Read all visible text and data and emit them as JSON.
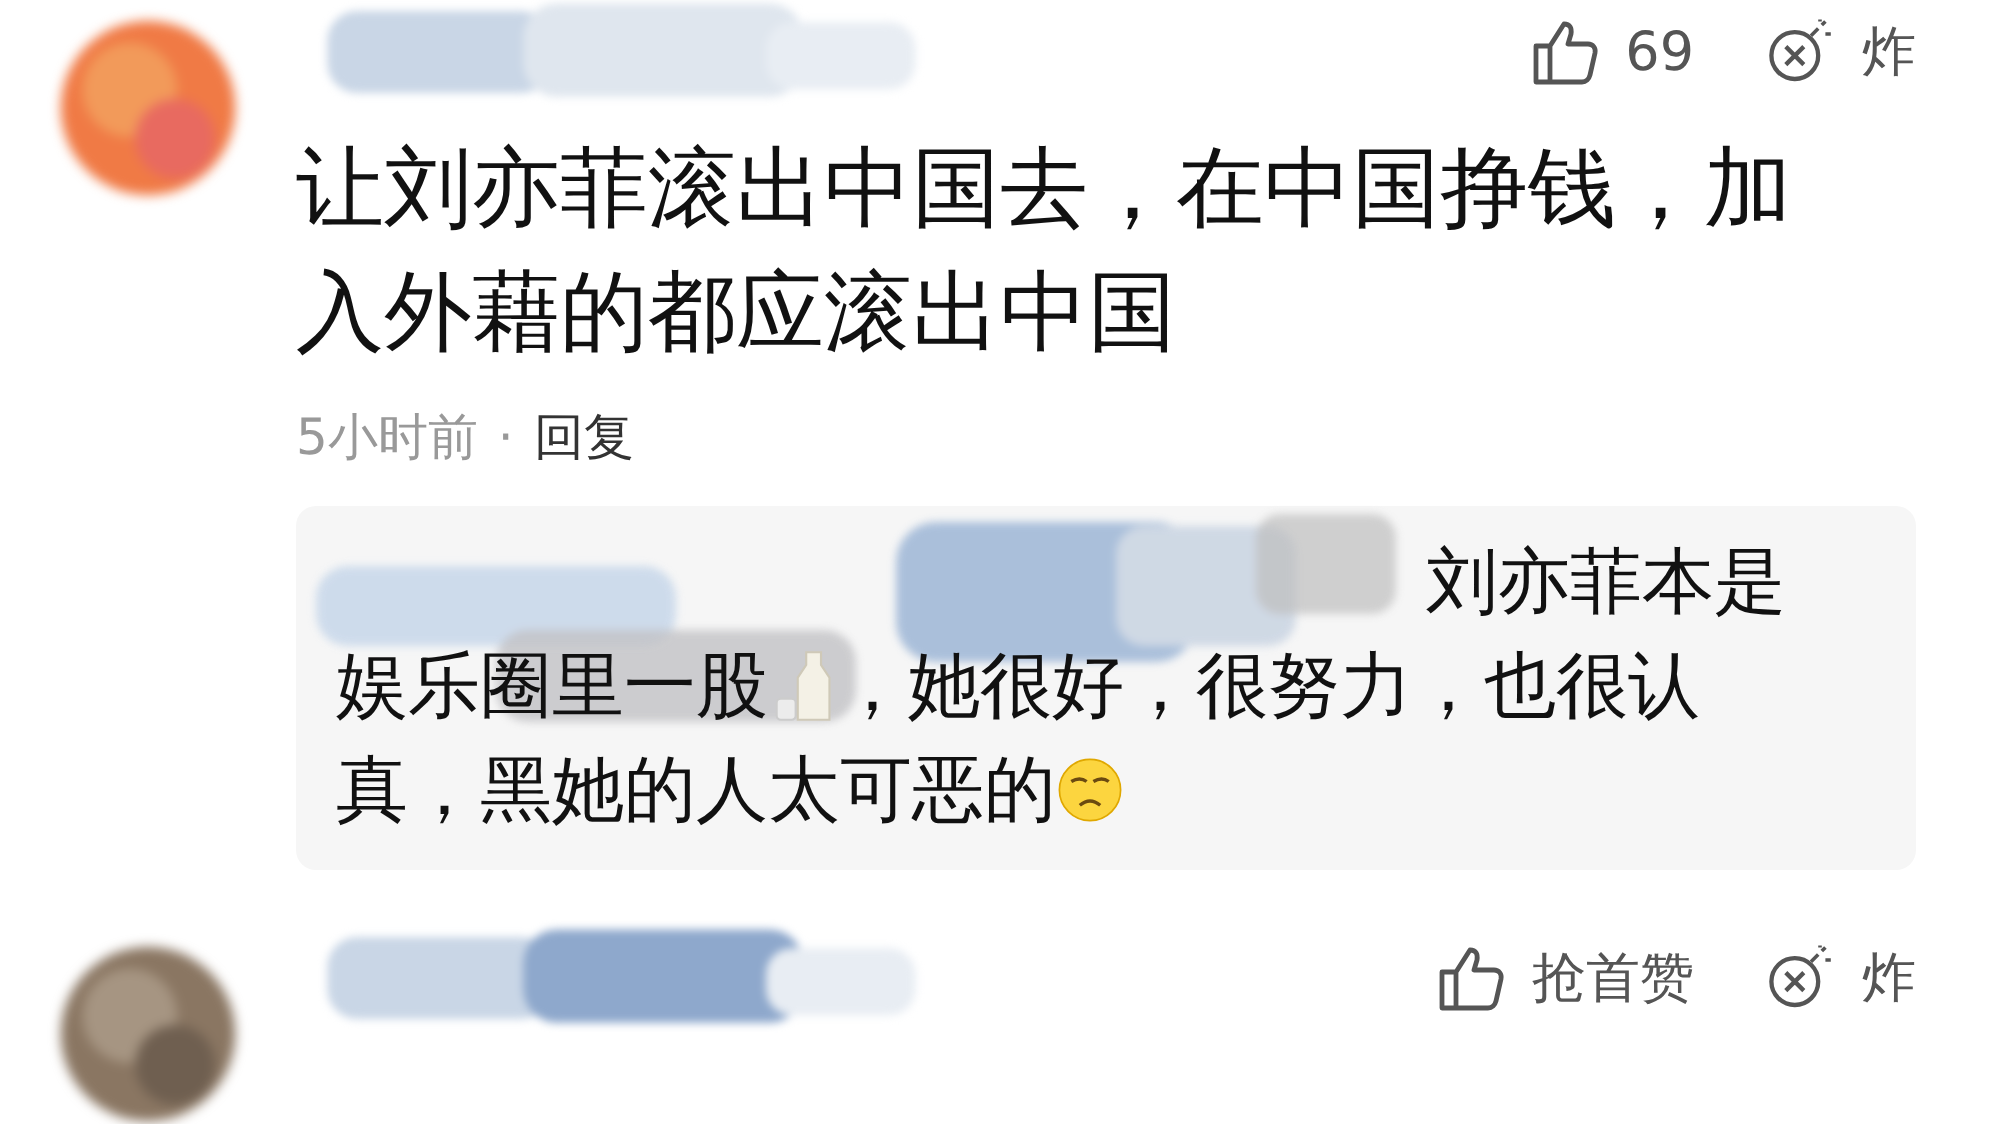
{
  "comments": [
    {
      "likes": "69",
      "bomb": "炸",
      "text": "让刘亦菲滚出中国去，在中国挣钱，加入外藉的都应滚出中国",
      "time": "5小时前",
      "separator": "·",
      "reply_label": "回复",
      "replies": [
        {
          "lines": [
            [
              {
                "kind": "text",
                "text": "刘亦菲本是"
              }
            ],
            [
              {
                "kind": "text",
                "text": "娱乐圈里一股"
              },
              {
                "kind": "milk"
              },
              {
                "kind": "text",
                "text": "，她很好，很努力，也很认"
              }
            ],
            [
              {
                "kind": "text",
                "text": "真，黑她的人太可恶的"
              },
              {
                "kind": "face"
              }
            ]
          ]
        }
      ]
    },
    {
      "likes": "抢首赞",
      "bomb": "炸"
    }
  ]
}
